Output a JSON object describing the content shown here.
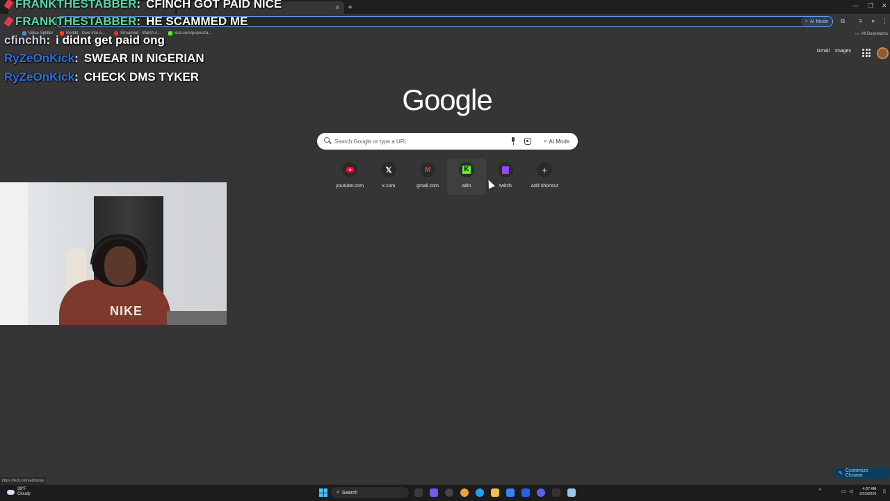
{
  "browser": {
    "tabs": [
      {
        "label": ""
      },
      {
        "label": ""
      }
    ],
    "omnibox_ai_label": "AI Mode",
    "bookmarks": [
      {
        "label": "Value Splitter",
        "color": "#4a90d9"
      },
      {
        "label": "Reddit - Dive into a...",
        "color": "#ff4500"
      },
      {
        "label": "Streamed - Watch A...",
        "color": "#d13b3b"
      },
      {
        "label": "kick.com/popout/a...",
        "color": "#53fc18"
      }
    ],
    "all_bookmarks": "All Bookmarks"
  },
  "chat": [
    {
      "user": "FRANKTHESTABBER",
      "message": "CFINCH GOT PAID NICE",
      "color": "#57d9a3",
      "badge": true
    },
    {
      "user": "FRANKTHESTABBER",
      "message": "HE SCAMMED ME",
      "color": "#57d9a3",
      "badge": true
    },
    {
      "user": "cfinchh",
      "message": "i didnt get paid ong",
      "color": "#c8d2e0",
      "badge": false
    },
    {
      "user": "RyZeOnKick",
      "message": "SWEAR IN NIGERIAN",
      "color": "#2f6fe0",
      "badge": false
    },
    {
      "user": "RyZeOnKick",
      "message": "CHECK DMS TYKER",
      "color": "#2f6fe0",
      "badge": false
    }
  ],
  "google": {
    "top_links": [
      "Gmail",
      "Images"
    ],
    "logo": "Google",
    "search_placeholder": "Search Google or type a URL",
    "ai_mode_label": "AI Mode",
    "shortcuts": [
      {
        "label": "youtube.com",
        "icon": "youtube-icon"
      },
      {
        "label": "x.com",
        "icon": "x-icon"
      },
      {
        "label": "gmail.com",
        "icon": "gmail-icon"
      },
      {
        "label": "adin",
        "icon": "kick-icon"
      },
      {
        "label": "twitch",
        "icon": "twitch-icon"
      },
      {
        "label": "Add shortcut",
        "icon": "plus-icon"
      }
    ],
    "customize_label": "Customize Chrome"
  },
  "status_url": "https://kick.com/adinross",
  "taskbar": {
    "weather_temp": "39°F",
    "weather_desc": "Cloudy",
    "search_label": "Search",
    "time": "4:37 AM",
    "date": "3/23/2026"
  }
}
